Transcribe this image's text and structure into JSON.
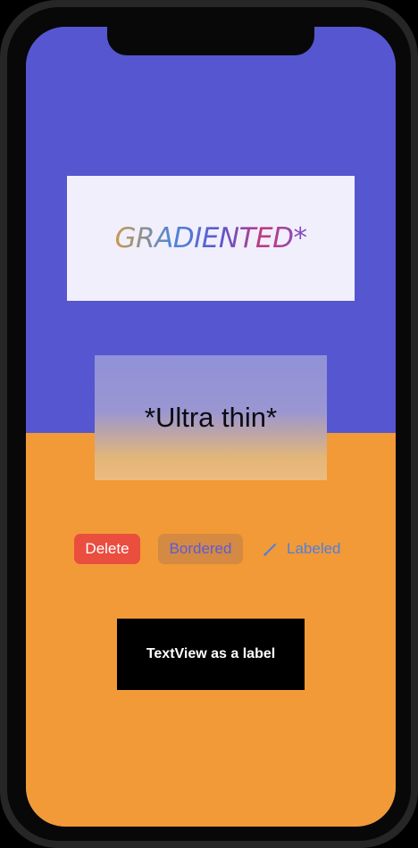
{
  "gradient_card": {
    "text": "GRADIENTED*"
  },
  "thin_card": {
    "text": "*Ultra thin*"
  },
  "buttons": {
    "delete_label": "Delete",
    "bordered_label": "Bordered",
    "labeled_label": "Labeled",
    "labeled_icon": "pencil-icon"
  },
  "textview": {
    "text": "TextView as a label"
  },
  "colors": {
    "top_background": "#5656d0",
    "bottom_background": "#f29a37",
    "delete_red": "#e94e3f",
    "accent_blue": "#4d7fe0"
  }
}
